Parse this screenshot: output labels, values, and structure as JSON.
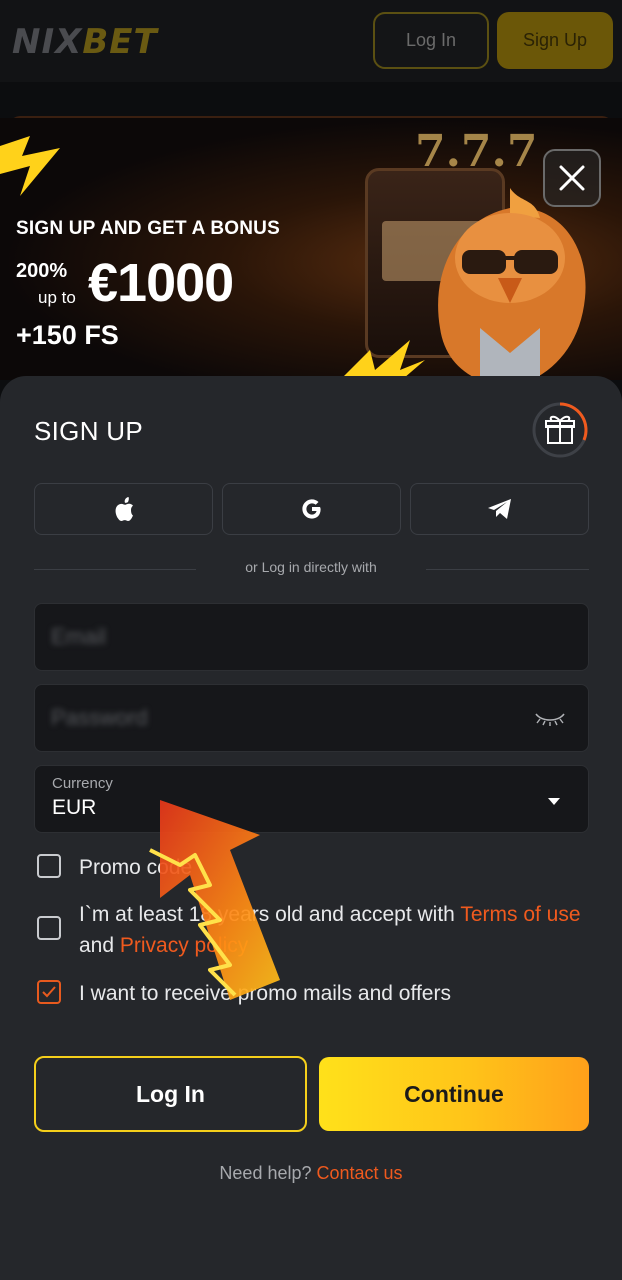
{
  "header": {
    "logo_part1": "NIX",
    "logo_part2": "BET",
    "login_label": "Log In",
    "signup_label": "Sign Up"
  },
  "banner": {
    "title": "SIGN UP AND GET A BONUS",
    "percent": "200%",
    "up_to": "up to",
    "amount": "€1000",
    "free_spins": "+150 FS",
    "slot_digits": "7.7.7"
  },
  "signup": {
    "title": "SIGN UP",
    "divider_text": "or Log in directly with",
    "social": [
      "apple-icon",
      "google-icon",
      "telegram-icon"
    ],
    "email_placeholder": "Email",
    "password_placeholder": "Password",
    "currency_label": "Currency",
    "currency_value": "EUR",
    "checkboxes": {
      "promo_code": "Promo code",
      "age_prefix": "I`m at least 18 years old and accept with ",
      "terms": "Terms of use",
      "and": " and ",
      "privacy": "Privacy policy",
      "mails": "I want to receive promo mails and offers"
    },
    "mails_checked": true,
    "login_button": "Log In",
    "continue_button": "Continue",
    "help_text": "Need help?",
    "contact_link": "Contact us"
  },
  "colors": {
    "accent_yellow": "#f5cf1b",
    "accent_orange": "#f05a1e",
    "sheet_bg": "#25272b"
  }
}
